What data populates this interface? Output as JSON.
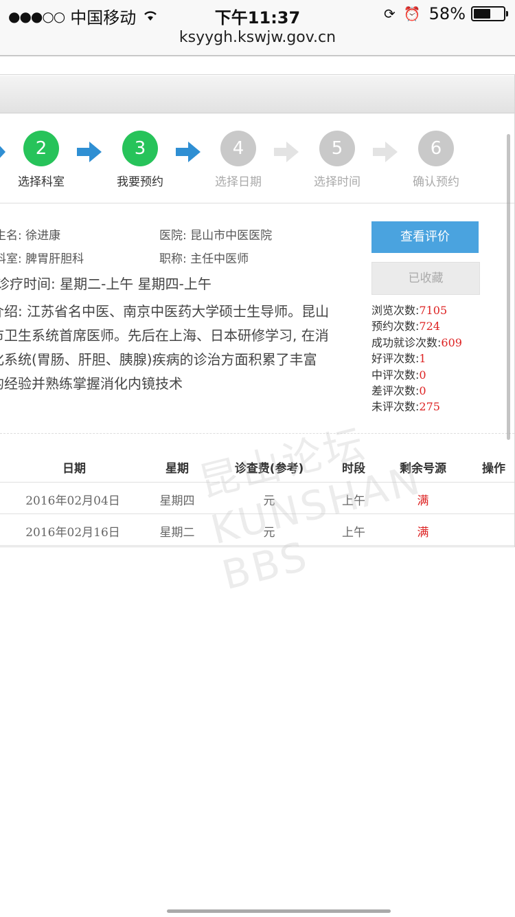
{
  "status": {
    "carrier": "中国移动",
    "time": "下午11:37",
    "battery": "58%",
    "battery_level": 0.58
  },
  "url": "ksyygh.kswjw.gov.cn",
  "steps": [
    {
      "num": "2",
      "label": "选择科室",
      "active": true
    },
    {
      "num": "3",
      "label": "我要预约",
      "active": true
    },
    {
      "num": "4",
      "label": "选择日期",
      "active": false
    },
    {
      "num": "5",
      "label": "选择时间",
      "active": false
    },
    {
      "num": "6",
      "label": "确认预约",
      "active": false
    }
  ],
  "doctor": {
    "name_label": "生名:",
    "name": "徐进康",
    "hospital_label": "医院:",
    "hospital": "昆山市中医医院",
    "dept_label": "科室:",
    "dept": "脾胃肝胆科",
    "title_label": "职称:",
    "title": "主任中医师",
    "schedule": "诊疗时间: 星期二-上午 星期四-上午",
    "intro_lines": [
      "介绍: 江苏省名中医、南京中医药大学硕士生导师。昆山",
      "市卫生系统首席医师。先后在上海、日本研修学习, 在消",
      "化系统(胃肠、肝胆、胰腺)疾病的诊治方面积累了丰富",
      "的经验并熟练掌握消化内镜技术"
    ]
  },
  "buttons": {
    "view_reviews": "查看评价",
    "favorited": "已收藏"
  },
  "stats": [
    {
      "label": "浏览次数:",
      "value": "7105"
    },
    {
      "label": "预约次数:",
      "value": "724"
    },
    {
      "label": "成功就诊次数:",
      "value": "609"
    },
    {
      "label": "好评次数:",
      "value": "1"
    },
    {
      "label": "中评次数:",
      "value": "0"
    },
    {
      "label": "差评次数:",
      "value": "0"
    },
    {
      "label": "未评次数:",
      "value": "275"
    }
  ],
  "table": {
    "headers": [
      "日期",
      "星期",
      "诊查费(参考)",
      "时段",
      "剩余号源",
      "操作"
    ],
    "rows": [
      {
        "date": "2016年02月04日",
        "weekday": "星期四",
        "fee": "元",
        "period": "上午",
        "remain": "满"
      },
      {
        "date": "2016年02月16日",
        "weekday": "星期二",
        "fee": "元",
        "period": "上午",
        "remain": "满"
      }
    ]
  },
  "watermark": "昆山论坛 KUNSHAN BBS"
}
